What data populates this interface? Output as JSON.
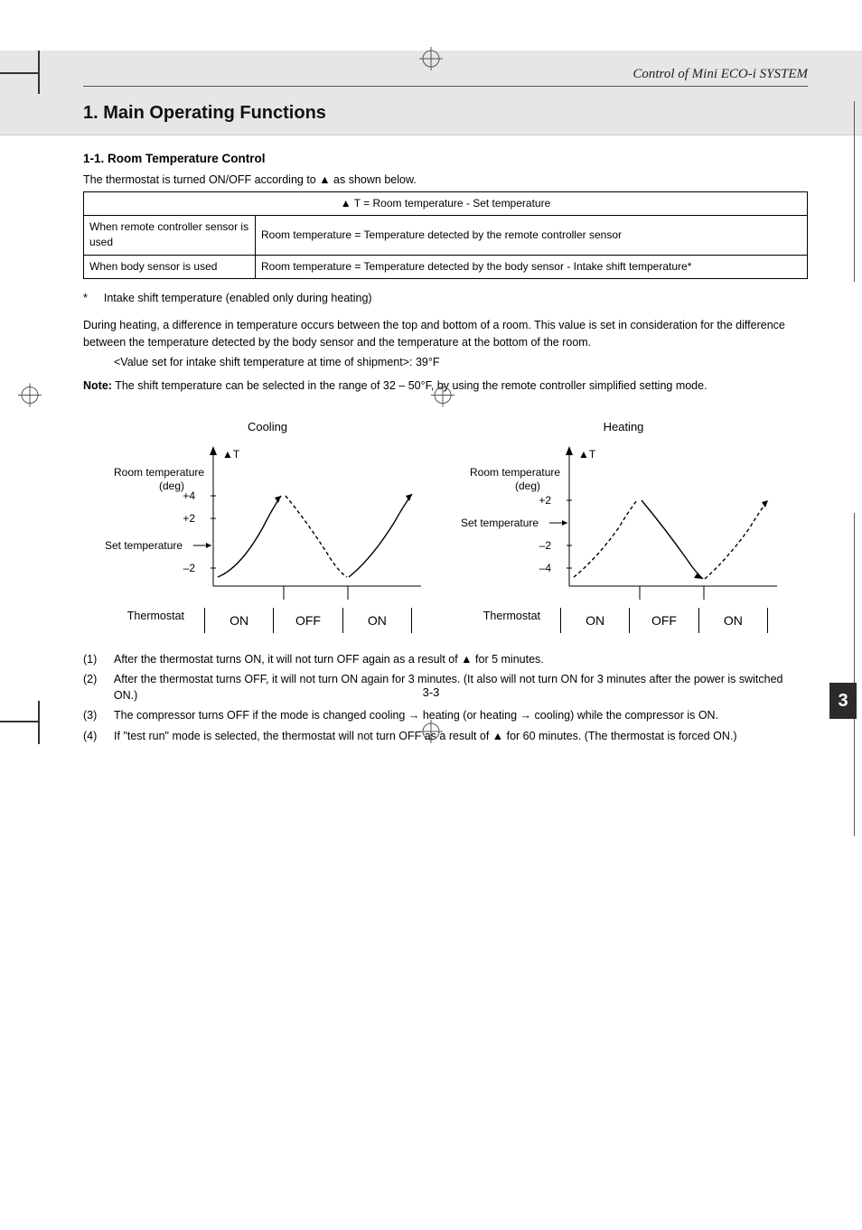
{
  "chapter_title": "Control of Mini ECO-i SYSTEM",
  "section_title": "1. Main Operating Functions",
  "subsection_title": "1-1. Room Temperature Control",
  "intro_text": "The thermostat is turned ON/OFF according to ▲ as shown below.",
  "table": {
    "header": "▲ T = Room temperature - Set temperature",
    "rows": [
      {
        "left": "When remote controller sensor is used",
        "right": "Room temperature = Temperature detected by the remote controller sensor"
      },
      {
        "left": "When body sensor is used",
        "right": "Room temperature = Temperature detected by the body sensor - Intake shift temperature*"
      }
    ]
  },
  "star_symbol": "*",
  "star_note": "Intake shift temperature (enabled only during heating)",
  "para1": "During heating, a difference in temperature occurs between the top and bottom of a room. This value is set in consideration for the difference between the temperature detected by the body sensor and the temperature at the bottom of the room.",
  "para1_sub": "<Value set for intake shift temperature at time of shipment>: 39°F",
  "note_label": "Note:",
  "note_text": "The shift temperature can be selected in the range of 32 – 50°F, by using the remote controller simplified setting mode.",
  "diagrams": {
    "cooling": {
      "title": "Cooling",
      "sym": "▲T",
      "y_label": "Room temperature (deg)",
      "ticks": [
        "+4",
        "+2",
        "–2"
      ],
      "set_label": "Set temperature",
      "thermostat_label": "Thermostat",
      "states": [
        "ON",
        "OFF",
        "ON"
      ]
    },
    "heating": {
      "title": "Heating",
      "sym": "▲T",
      "y_label": "Room temperature (deg)",
      "ticks": [
        "+2",
        "–2",
        "–4"
      ],
      "set_label": "Set temperature",
      "thermostat_label": "Thermostat",
      "states": [
        "ON",
        "OFF",
        "ON"
      ]
    }
  },
  "notes": [
    {
      "n": "(1)",
      "t": "After the thermostat turns ON, it will not turn OFF again as a result of ▲ for 5 minutes."
    },
    {
      "n": "(2)",
      "t": "After the thermostat turns OFF, it will not turn ON again for 3 minutes. (It also will not turn ON for 3 minutes after the power is switched ON.)"
    },
    {
      "n": "(3)",
      "t": "The compressor turns OFF if the mode is changed cooling → heating (or heating → cooling) while the compressor is ON."
    },
    {
      "n": "(4)",
      "t": "If \"test run\" mode is selected, the thermostat will not turn OFF as a result of ▲ for 60 minutes. (The thermostat is forced ON.)"
    }
  ],
  "side_tab": "3",
  "page_number": "3-3",
  "chart_data": [
    {
      "type": "line",
      "title": "Cooling",
      "ylabel": "Room temperature (deg)",
      "y_ticks": [
        -2,
        2,
        4
      ],
      "set_temperature_line_at": 0,
      "series": [
        {
          "name": "upper",
          "points": [
            [
              0,
              -2
            ],
            [
              1,
              4
            ],
            [
              2,
              -2.2
            ],
            [
              3,
              4
            ]
          ]
        },
        {
          "name": "lower_dashed",
          "points": [
            [
              1,
              4
            ],
            [
              2,
              -2.2
            ]
          ]
        }
      ],
      "thermostat_states": [
        "ON",
        "OFF",
        "ON"
      ]
    },
    {
      "type": "line",
      "title": "Heating",
      "ylabel": "Room temperature (deg)",
      "y_ticks": [
        -4,
        -2,
        2
      ],
      "set_temperature_line_at": 0,
      "series": [
        {
          "name": "upper_dashed",
          "points": [
            [
              0,
              -4
            ],
            [
              1,
              2
            ],
            [
              2,
              -4.2
            ]
          ]
        },
        {
          "name": "lower",
          "points": [
            [
              0,
              2
            ],
            [
              1,
              2
            ],
            [
              2,
              -4.2
            ],
            [
              3,
              2
            ]
          ]
        }
      ],
      "thermostat_states": [
        "ON",
        "OFF",
        "ON"
      ]
    }
  ]
}
